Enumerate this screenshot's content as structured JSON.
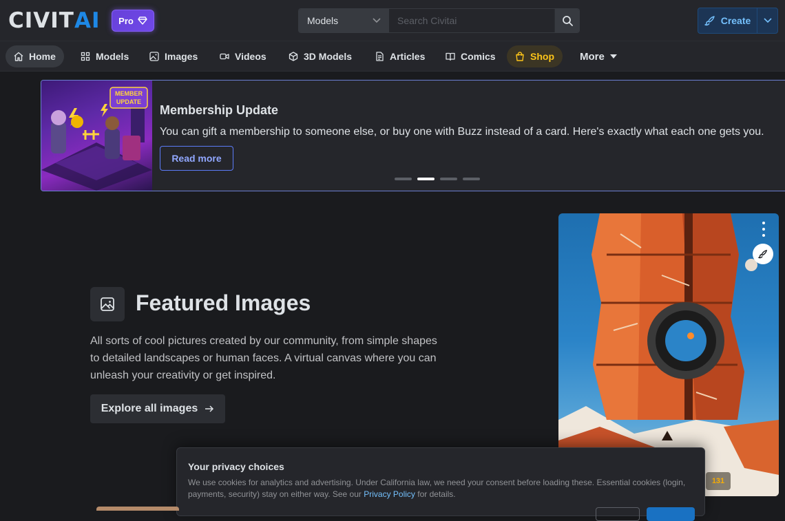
{
  "header": {
    "logo_main": "CIVIT",
    "logo_accent": "AI",
    "pro_label": "Pro",
    "search": {
      "scope": "Models",
      "placeholder": "Search Civitai",
      "shortcut": "/"
    },
    "create_label": "Create"
  },
  "nav": {
    "items": [
      {
        "label": "Home",
        "icon": "home-icon"
      },
      {
        "label": "Models",
        "icon": "grid-icon"
      },
      {
        "label": "Images",
        "icon": "photo-icon"
      },
      {
        "label": "Videos",
        "icon": "video-icon"
      },
      {
        "label": "3D Models",
        "icon": "cube-icon"
      },
      {
        "label": "Articles",
        "icon": "article-icon"
      },
      {
        "label": "Comics",
        "icon": "book-icon"
      },
      {
        "label": "Shop",
        "icon": "shopping-bag-icon"
      },
      {
        "label": "More",
        "icon": "caret-down-icon"
      }
    ],
    "active": "Home"
  },
  "banner": {
    "art_text": "MEMBER UPDATE",
    "title": "Membership Update",
    "text": "You can gift a membership to someone else, or buy one with Buzz instead of a card. Here's exactly what each one gets you.",
    "button_label": "Read more",
    "slide_count": 4,
    "active_slide": 2
  },
  "featured": {
    "title": "Featured Images",
    "description": "All sorts of cool pictures created by our community, from simple shapes to detailed landscapes or human faces. A virtual canvas where you can unleash your creativity or get inspired.",
    "button_label": "Explore all images",
    "card": {
      "stat": "131"
    }
  },
  "privacy": {
    "title": "Your privacy choices",
    "text_before": "We use cookies for analytics and advertising. Under California law, we need your consent before loading these. Essential cookies (login, payments, security) stay on either way. See our ",
    "link": "Privacy Policy",
    "text_after": " for details."
  },
  "colors": {
    "background": "#1a1b1e",
    "surface": "#25262b",
    "accent_blue": "#1e88e5",
    "pro_purple": "#7048e8",
    "shop_yellow": "#fcc419"
  }
}
